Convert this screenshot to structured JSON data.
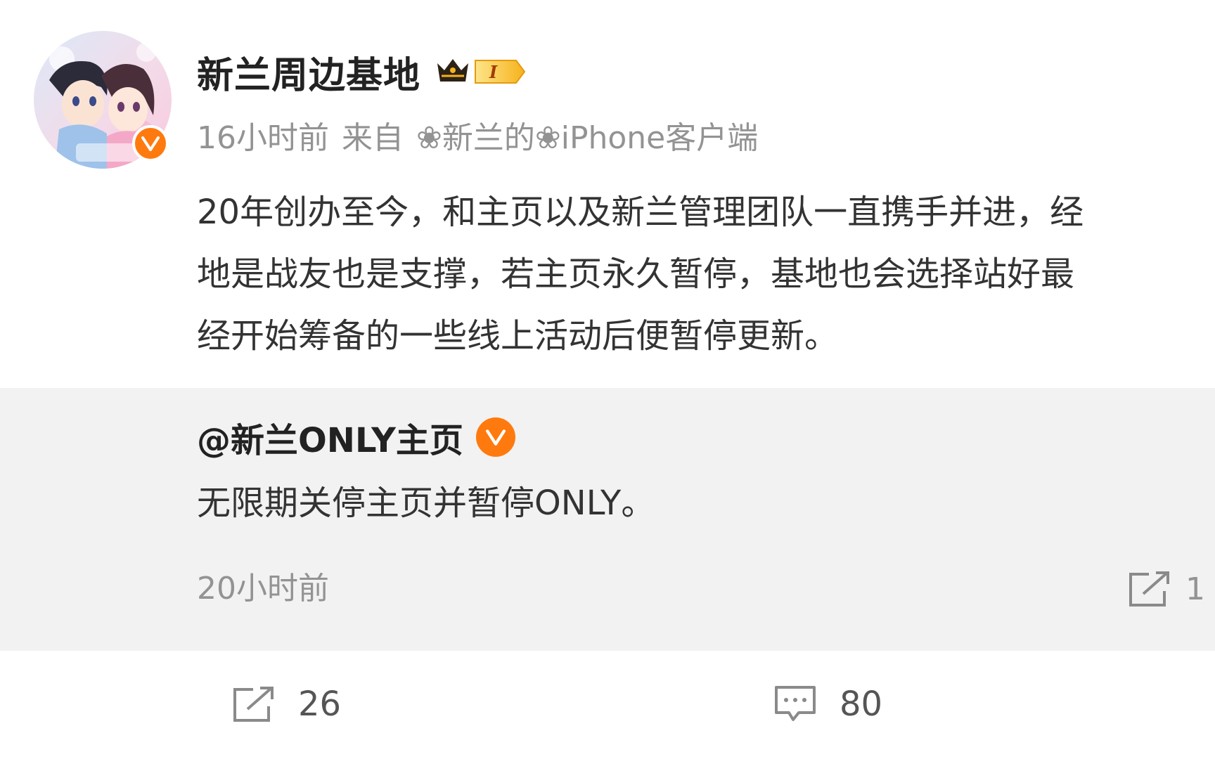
{
  "post": {
    "author": "新兰周边基地",
    "time": "16小时前",
    "from_label": "来自",
    "source": "❀新兰的❀iPhone客户端",
    "text_lines": [
      "20年创办至今，和主页以及新兰管理团队一直携手并进，经",
      "地是战友也是支撑，若主页永久暂停，基地也会选择站好最",
      "经开始筹备的一些线上活动后便暂停更新。"
    ],
    "vip_level": "I"
  },
  "retweet": {
    "author": "@新兰ONLY主页",
    "text": "无限期关停主页并暂停ONLY。",
    "time": "20小时前",
    "share_count": "1"
  },
  "actions": {
    "repost_count": "26",
    "comment_count": "80"
  },
  "colors": {
    "verified_orange": "#ff7a0e",
    "retweet_bg": "#f2f2f2",
    "meta_gray": "#939393",
    "vip_gold": "#f7b21c"
  },
  "icons": {
    "verified": "verified-v-icon",
    "vip": "crown-icon",
    "repost": "share-arrow-icon",
    "comment": "comment-bubble-icon"
  }
}
